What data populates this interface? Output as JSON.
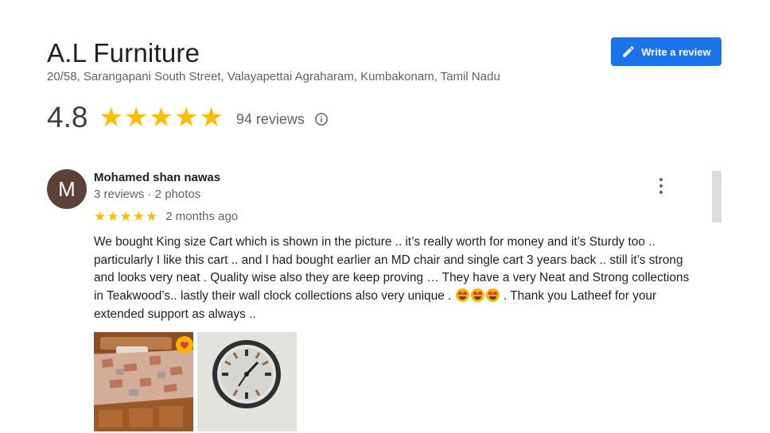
{
  "business": {
    "name": "A.L Furniture",
    "address": "20/58, Sarangapani South Street, Valayapettai Agraharam, Kumbakonam, Tamil Nadu",
    "rating": "4.8",
    "stars": 5,
    "review_count_label": "94 reviews"
  },
  "toolbar": {
    "write_review_label": "Write a review"
  },
  "review": {
    "avatar_letter": "M",
    "author": "Mohamed shan nawas",
    "author_meta": "3 reviews · 2 photos",
    "stars": 5,
    "date": "2 months ago",
    "text_part1": "We bought King size Cart which is shown in the picture .. it’s really worth for money and it’s Sturdy too .. particularly I like this cart .. and I had bought earlier an MD chair and single cart 3 years back .. still it’s strong and looks very neat . Quality wise also they are keep proving … They have a very Neat and Strong collections in Teakwood’s.. lastly their wall clock collections also very unique .",
    "text_part2": ". Thank you Latheef for your extended support as always ..",
    "emoji_count": 3,
    "photos": [
      "bed-photo",
      "wall-clock-photo"
    ]
  },
  "colors": {
    "accent": "#1a73e8",
    "star": "#fbbc04",
    "avatar_bg": "#5d4037",
    "muted_text": "#5f6368"
  }
}
